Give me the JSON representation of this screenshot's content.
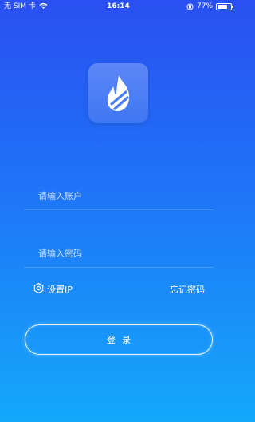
{
  "status_bar": {
    "carrier": "无 SIM 卡",
    "time": "16:14",
    "battery": "77%",
    "battery_level": 0.77,
    "wifi_icon": "wifi-icon",
    "lock_icon": "orientation-lock-icon"
  },
  "app": {
    "logo_icon": "flame-icon"
  },
  "login": {
    "account_placeholder": "请输入账户",
    "password_placeholder": "请输入密码",
    "settings_label": "设置IP",
    "settings_icon": "gear-icon",
    "forgot_label": "忘记密码",
    "submit_label": "登录"
  },
  "colors": {
    "gradient_top": "#2a4ff2",
    "gradient_bottom": "#14a8fb",
    "logo_bg": "#4a7ef4"
  }
}
